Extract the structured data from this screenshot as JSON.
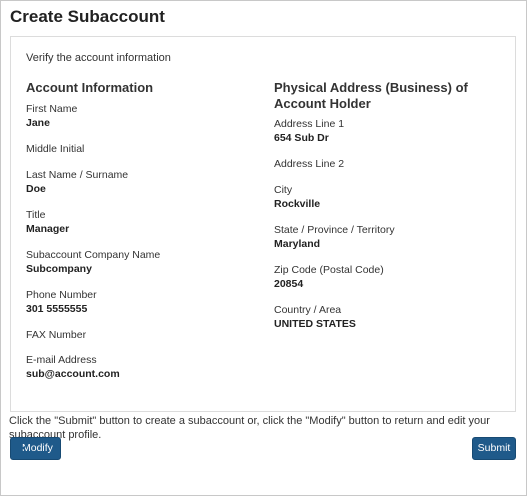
{
  "page": {
    "title": "Create Subaccount",
    "intro": "Verify the account information"
  },
  "account_info": {
    "heading": "Account Information",
    "fields": [
      {
        "label": "First Name",
        "value": "Jane"
      },
      {
        "label": "Middle Initial",
        "value": ""
      },
      {
        "label": "Last Name / Surname",
        "value": "Doe"
      },
      {
        "label": "Title",
        "value": "Manager"
      },
      {
        "label": "Subaccount Company Name",
        "value": "Subcompany"
      },
      {
        "label": "Phone Number",
        "value": "301 5555555"
      },
      {
        "label": "FAX Number",
        "value": ""
      },
      {
        "label": "E-mail Address",
        "value": "sub@account.com"
      }
    ]
  },
  "address": {
    "heading": "Physical Address (Business) of Account Holder",
    "fields": [
      {
        "label": "Address Line 1",
        "value": "654 Sub Dr"
      },
      {
        "label": "Address Line 2",
        "value": ""
      },
      {
        "label": "City",
        "value": "Rockville"
      },
      {
        "label": "State / Province / Territory",
        "value": "Maryland"
      },
      {
        "label": "Zip Code (Postal Code)",
        "value": "20854"
      },
      {
        "label": "Country / Area",
        "value": "UNITED STATES"
      }
    ]
  },
  "instructions": "Click the \"Submit\" button to create a subaccount or, click the \"Modify\" button to return and edit your subaccount profile.",
  "buttons": {
    "modify_label": "Modify",
    "modify_icon": "arrow-left-circle-icon",
    "submit_label": "Submit"
  },
  "colors": {
    "button_bg": "#1f5a8a",
    "panel_border": "#dcdcdc"
  }
}
